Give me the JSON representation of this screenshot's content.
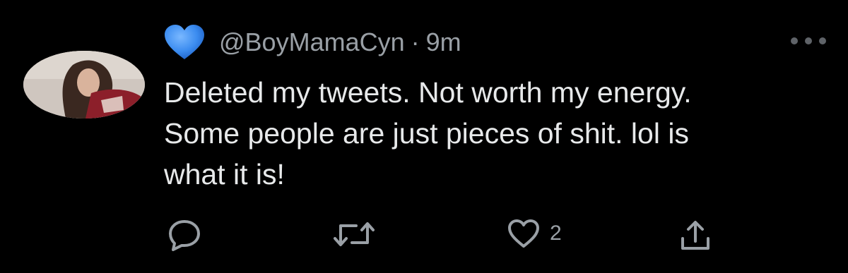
{
  "tweet": {
    "handle": "@BoyMamaCyn",
    "separator": "·",
    "time": "9m",
    "text_line1": "Deleted my tweets. Not worth my energy.",
    "text_line2": "Some people are just pieces of shit. lol is",
    "text_line3": "what it is!",
    "badge_icon": "blue-heart-icon",
    "avatar_icon": "profile-photo",
    "more_icon": "more-horizontal-icon"
  },
  "actions": {
    "reply_icon": "reply-icon",
    "retweet_icon": "retweet-icon",
    "like_icon": "heart-outline-icon",
    "like_count": "2",
    "share_icon": "share-icon"
  },
  "colors": {
    "background": "#000000",
    "text": "#e7e9ea",
    "muted": "#9aa0a6",
    "heart_blue": "#3b8cf0"
  }
}
